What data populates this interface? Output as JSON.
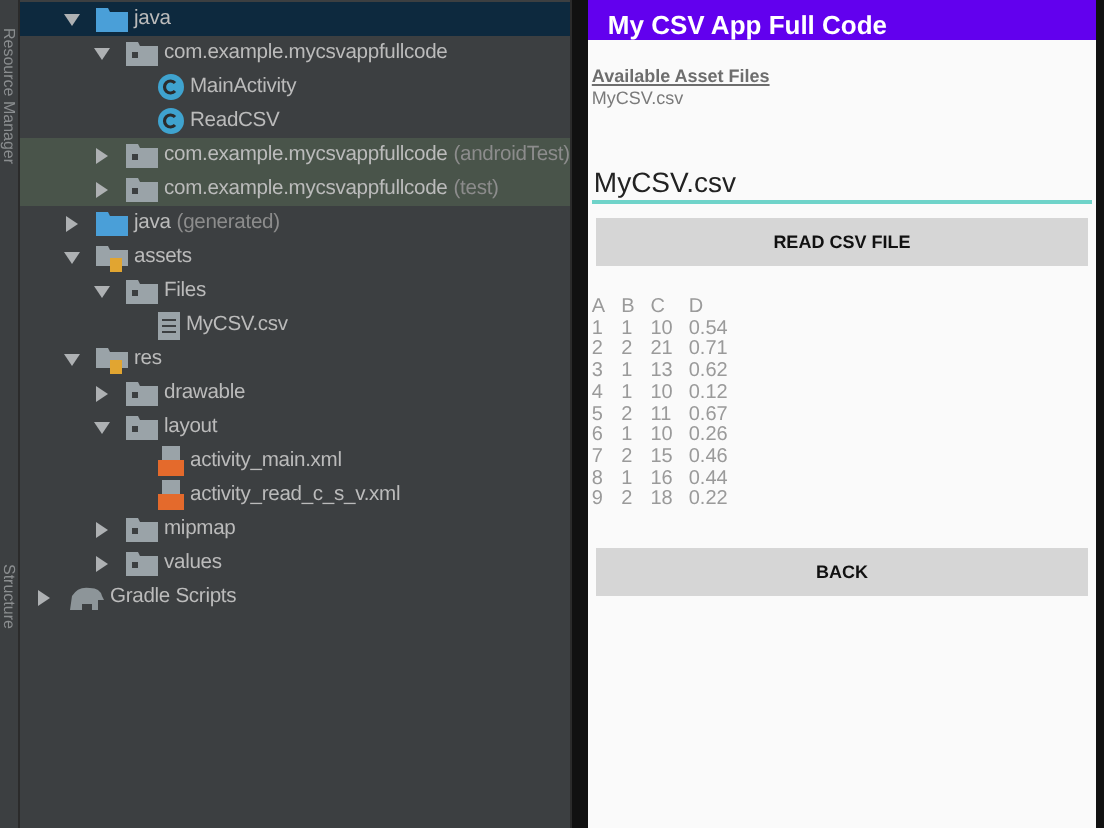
{
  "side_tabs": [
    "Resource Manager",
    "Structure"
  ],
  "project_tree": [
    {
      "label": "java",
      "kind": "folder",
      "expanded": true,
      "selected": true,
      "children": [
        {
          "label": "com.example.mycsvappfullcode",
          "kind": "package",
          "expanded": true,
          "selected": false,
          "children": [
            {
              "label": "MainActivity",
              "kind": "class",
              "selected": false
            },
            {
              "label": "ReadCSV",
              "kind": "class",
              "selected": false
            }
          ]
        },
        {
          "label": "com.example.mycsvappfullcode",
          "suffix": "(androidTest)",
          "kind": "package",
          "expanded": false,
          "selected": false,
          "test_source": true
        },
        {
          "label": "com.example.mycsvappfullcode",
          "suffix": "(test)",
          "kind": "package",
          "expanded": false,
          "selected": false,
          "test_source": true
        }
      ]
    },
    {
      "label": "java",
      "suffix": "(generated)",
      "kind": "folder",
      "expanded": false,
      "selected": false
    },
    {
      "label": "assets",
      "kind": "resfolder",
      "expanded": true,
      "selected": false,
      "children": [
        {
          "label": "Files",
          "kind": "package",
          "expanded": true,
          "selected": false,
          "children": [
            {
              "label": "MyCSV.csv",
              "kind": "file",
              "selected": false
            }
          ]
        }
      ]
    },
    {
      "label": "res",
      "kind": "resfolder",
      "expanded": true,
      "selected": false,
      "children": [
        {
          "label": "drawable",
          "kind": "package",
          "expanded": false,
          "selected": false
        },
        {
          "label": "layout",
          "kind": "package",
          "expanded": true,
          "selected": false,
          "children": [
            {
              "label": "activity_main.xml",
              "kind": "xml",
              "selected": false
            },
            {
              "label": "activity_read_c_s_v.xml",
              "kind": "xml",
              "selected": false
            }
          ]
        },
        {
          "label": "mipmap",
          "kind": "package",
          "expanded": false,
          "selected": false
        },
        {
          "label": "values",
          "kind": "package",
          "expanded": false,
          "selected": false
        }
      ]
    },
    {
      "label": "Gradle Scripts",
      "kind": "gradle",
      "expanded": false,
      "selected": false
    }
  ],
  "app": {
    "title": "My CSV App Full Code",
    "assets_heading": "Available Asset Files",
    "assets_file": "MyCSV.csv",
    "file_field": {
      "value": "MyCSV.csv"
    },
    "read_button": "READ CSV FILE",
    "table": {
      "columns": [
        "A",
        "B",
        "C",
        "D"
      ],
      "rows": [
        [
          "1",
          "1",
          "10",
          "0.54"
        ],
        [
          "2",
          "2",
          "21",
          "0.71"
        ],
        [
          "3",
          "1",
          "13",
          "0.62"
        ],
        [
          "4",
          "1",
          "10",
          "0.12"
        ],
        [
          "5",
          "2",
          "11",
          "0.67"
        ],
        [
          "6",
          "1",
          "10",
          "0.26"
        ],
        [
          "7",
          "2",
          "15",
          "0.46"
        ],
        [
          "8",
          "1",
          "16",
          "0.44"
        ],
        [
          "9",
          "2",
          "18",
          "0.22"
        ]
      ]
    },
    "back_button": "BACK"
  }
}
